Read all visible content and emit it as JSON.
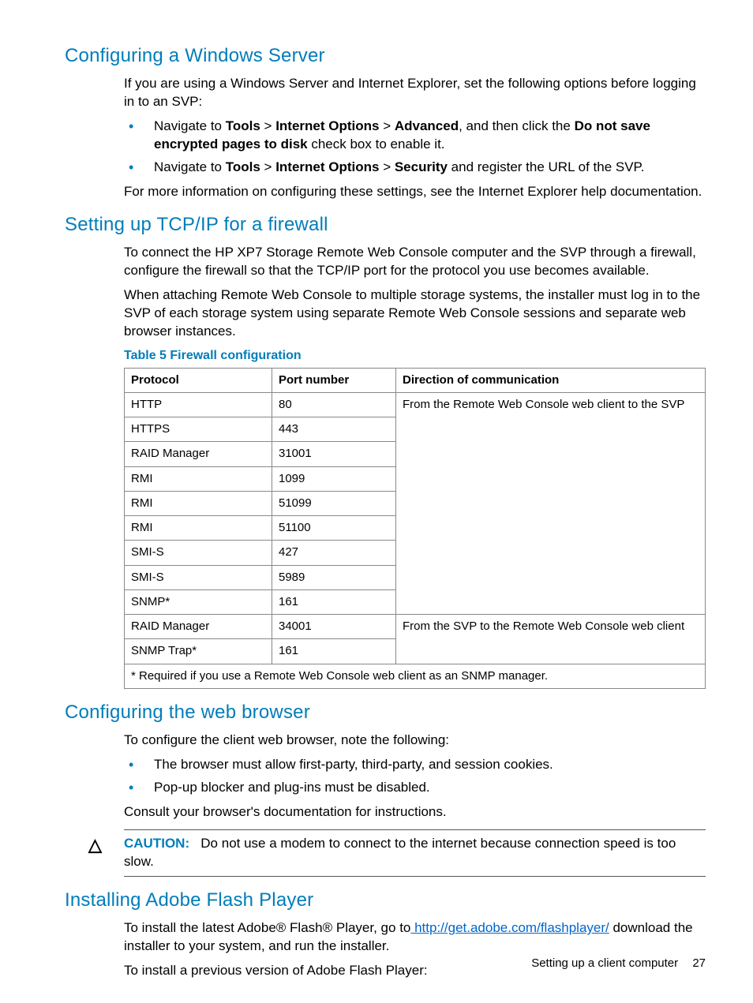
{
  "sec1": {
    "heading": "Configuring a Windows Server",
    "p1": "If you are using a Windows Server and Internet Explorer, set the following options before logging in to an SVP:",
    "li1_a": "Navigate to ",
    "li1_b": "Tools",
    "li1_c": " > ",
    "li1_d": "Internet Options",
    "li1_e": " > ",
    "li1_f": "Advanced",
    "li1_g": ", and then click the ",
    "li1_h": "Do not save encrypted pages to disk",
    "li1_i": " check box to enable it.",
    "li2_a": "Navigate to ",
    "li2_b": "Tools",
    "li2_c": " > ",
    "li2_d": "Internet Options",
    "li2_e": " > ",
    "li2_f": "Security",
    "li2_g": " and register the URL of the SVP.",
    "p2": "For more information on configuring these settings, see the Internet Explorer help documentation."
  },
  "sec2": {
    "heading": "Setting up TCP/IP for a firewall",
    "p1": "To connect the HP XP7 Storage Remote Web Console computer and the SVP through a firewall, configure the firewall so that the TCP/IP port for the protocol you use becomes available.",
    "p2": "When attaching Remote Web Console to multiple storage systems, the installer must log in to the SVP of each storage system using separate Remote Web Console sessions and separate web browser instances.",
    "table_caption": "Table 5 Firewall configuration",
    "headers": {
      "c1": "Protocol",
      "c2": "Port number",
      "c3": "Direction of communication"
    },
    "rows_group1_dir": "From the Remote Web Console web client to the SVP",
    "rows_group1": [
      {
        "proto": "HTTP",
        "port": "80"
      },
      {
        "proto": "HTTPS",
        "port": "443"
      },
      {
        "proto": "RAID Manager",
        "port": "31001"
      },
      {
        "proto": "RMI",
        "port": "1099"
      },
      {
        "proto": "RMI",
        "port": "51099"
      },
      {
        "proto": "RMI",
        "port": "51100"
      },
      {
        "proto": "SMI-S",
        "port": "427"
      },
      {
        "proto": "SMI-S",
        "port": "5989"
      },
      {
        "proto": "SNMP*",
        "port": "161"
      }
    ],
    "rows_group2_dir": "From the SVP to the Remote Web Console web client",
    "rows_group2": [
      {
        "proto": "RAID Manager",
        "port": "34001"
      },
      {
        "proto": "SNMP Trap*",
        "port": "161"
      }
    ],
    "footnote": "* Required if you use a Remote Web Console web client as an SNMP manager."
  },
  "sec3": {
    "heading": "Configuring the web browser",
    "p1": "To configure the client web browser, note the following:",
    "li1": "The browser must allow first-party, third-party, and session cookies.",
    "li2": "Pop-up blocker and plug-ins must be disabled.",
    "p2": "Consult your browser's documentation for instructions.",
    "caution_label": "CAUTION:",
    "caution_text": "Do not use a modem to connect to the internet because connection speed is too slow."
  },
  "sec4": {
    "heading": "Installing Adobe Flash Player",
    "p1_a": "To install the latest Adobe® Flash® Player, go to",
    "p1_link": " http://get.adobe.com/flashplayer/",
    "p1_b": " download the installer to your system, and run the installer.",
    "p2": "To install a previous version of Adobe Flash Player:"
  },
  "footer": {
    "text": "Setting up a client computer",
    "page": "27"
  }
}
